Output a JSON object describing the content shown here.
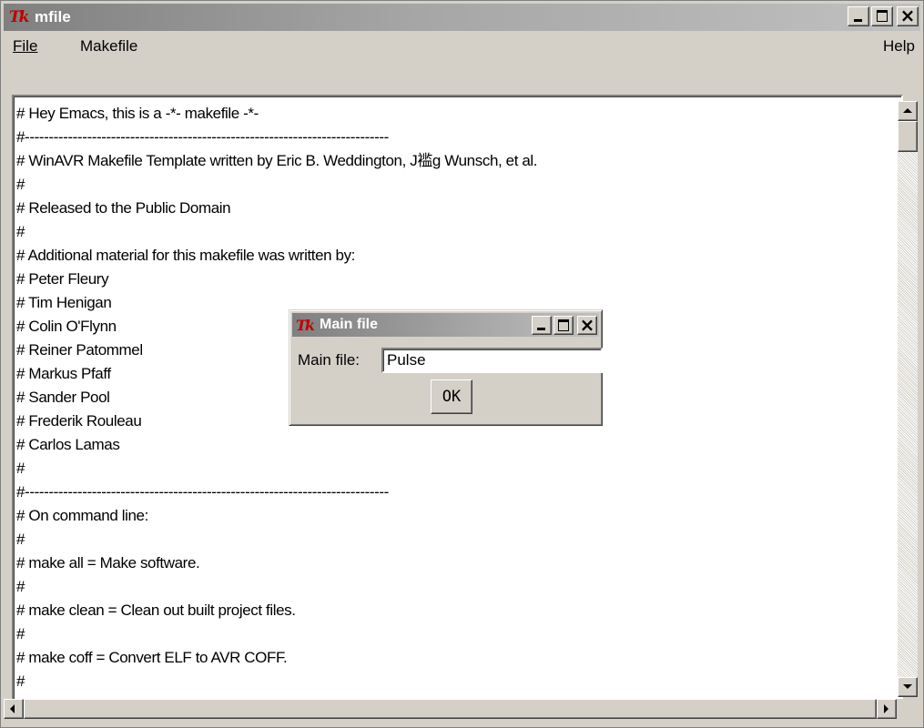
{
  "window": {
    "app_icon": "Tk",
    "title": "mfile",
    "controls": [
      "minimize",
      "maximize",
      "close"
    ]
  },
  "menubar": {
    "file": "File",
    "makefile": "Makefile",
    "help": "Help"
  },
  "editor": {
    "lines": [
      "# Hey Emacs, this is a -*- makefile -*-",
      "#----------------------------------------------------------------------------",
      "# WinAVR Makefile Template written by Eric B. Weddington, J褴g Wunsch, et al.",
      "#",
      "# Released to the Public Domain",
      "#",
      "# Additional material for this makefile was written by:",
      "# Peter Fleury",
      "# Tim Henigan",
      "# Colin O'Flynn",
      "# Reiner Patommel",
      "# Markus Pfaff",
      "# Sander Pool",
      "# Frederik Rouleau",
      "# Carlos Lamas",
      "#",
      "#----------------------------------------------------------------------------",
      "# On command line:",
      "#",
      "# make all = Make software.",
      "#",
      "# make clean = Clean out built project files.",
      "#",
      "# make coff = Convert ELF to AVR COFF.",
      "#"
    ]
  },
  "dialog": {
    "app_icon": "Tk",
    "title": "Main file",
    "label": "Main file:",
    "input_value": "Pulse",
    "ok_label": "OK"
  }
}
